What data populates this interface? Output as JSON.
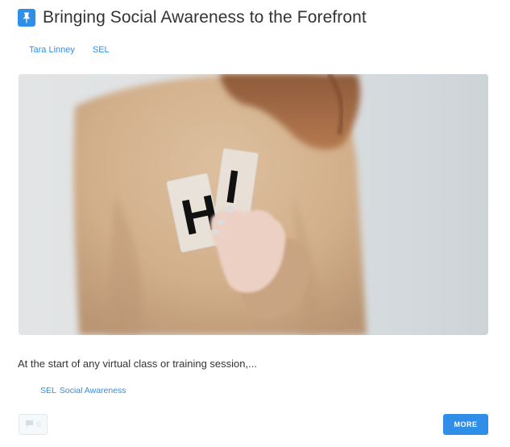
{
  "post": {
    "title": "Bringing Social Awareness to the Forefront",
    "pin_icon": "pin-icon",
    "author": "Tara Linney",
    "category": "SEL",
    "hero_image": {
      "card_letters": [
        "H",
        "I"
      ]
    },
    "excerpt": "At the start of any virtual class or training session,...",
    "tags": [
      "SEL",
      "Social Awareness"
    ],
    "comment_icon": "speech-bubble-icon",
    "comment_count": "0",
    "more_label": "MORE"
  },
  "colors": {
    "accent": "#2f8fe8",
    "title_text": "#333333",
    "comment_bg": "#f6f9fc"
  }
}
